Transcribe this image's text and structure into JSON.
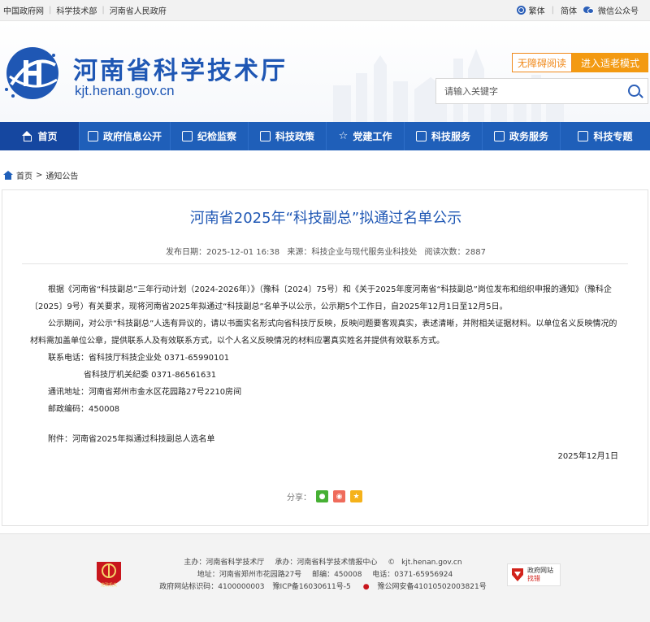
{
  "topbar": {
    "links": [
      "中国政府网",
      "科学技术部",
      "河南省人民政府"
    ],
    "traditional": "繁体",
    "simplified": "简体",
    "wechat": "微信公众号"
  },
  "header": {
    "site_title": "河南省科学技术厅",
    "site_domain": "kjt.henan.gov.cn",
    "accessible_label": "无障碍阅读",
    "elder_label": "进入适老模式",
    "search_placeholder": "请输入关键字"
  },
  "nav": {
    "items": [
      "首页",
      "政府信息公开",
      "纪检监察",
      "科技政策",
      "党建工作",
      "科技服务",
      "政务服务",
      "科技专题"
    ]
  },
  "breadcrumb": {
    "home": "首页",
    "sep": ">",
    "current": "通知公告"
  },
  "article": {
    "title": "河南省2025年“科技副总”拟通过名单公示",
    "publish_date": "发布日期：2025-12-01 16:38",
    "source": "来源：科技企业与现代服务业科技处",
    "views": "阅读次数：2887",
    "para1": "根据《河南省“科技副总”三年行动计划（2024-2026年）》（豫科〔2024〕75号）和《关于2025年度河南省“科技副总”岗位发布和组织申报的通知》（豫科企〔2025〕9号）有关要求，现将河南省2025年拟通过“科技副总”名单予以公示，公示期5个工作日，自2025年12月1日至12月5日。",
    "para2": "公示期间，对公示“科技副总”人选有异议的，请以书面实名形式向省科技厅反映，反映问题要客观真实，表述清晰，并附相关证据材料。以单位名义反映情况的材料需加盖单位公章，提供联系人及有效联系方式，以个人名义反映情况的材料应署真实姓名并提供有效联系方式。",
    "phone1": "联系电话：省科技厅科技企业处 0371-65990101",
    "phone2": "省科技厅机关纪委 0371-86561631",
    "address": "通讯地址：河南省郑州市金水区花园路27号2210房间",
    "postcode": "邮政编码：450008",
    "attachment": "附件：河南省2025年拟通过科技副总人选名单",
    "date": "2025年12月1日",
    "share_label": "分享："
  },
  "footer": {
    "host": "主办：河南省科学技术厅",
    "undertaker": "承办：河南省科学技术情报中心",
    "email": "kjt.henan.gov.cn",
    "address": "地址：河南省郑州市花园路27号",
    "postcode": "邮编：450008",
    "phone": "电话：0371-65956924",
    "site_code": "政府网站标识码：4100000003",
    "icp": "豫ICP备16030611号-5",
    "police": "豫公网安备41010502003821号",
    "party_badge": "党政机关",
    "gov_badge_1": "政府网站",
    "gov_badge_2": "找错"
  },
  "colors": {
    "brand_blue": "#1f5fb9",
    "orange": "#f39a12"
  }
}
